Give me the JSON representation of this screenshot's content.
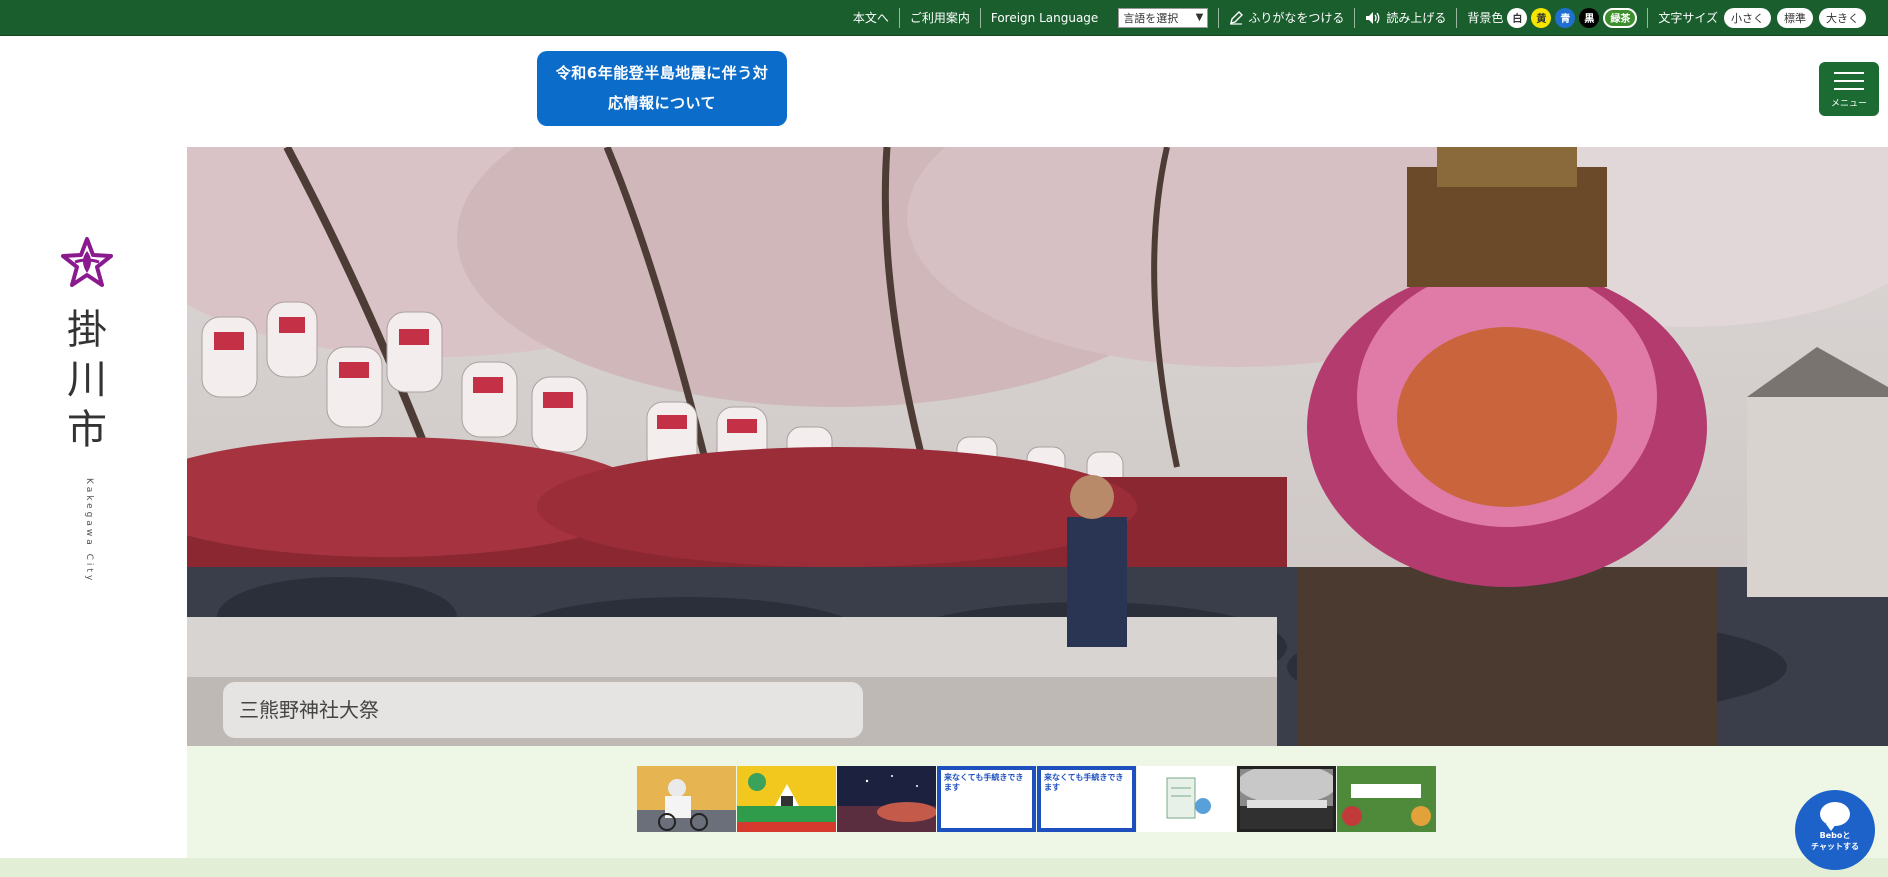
{
  "topbar": {
    "skip_to_main": "本文へ",
    "usage_guide": "ご利用案内",
    "foreign_language": "Foreign Language",
    "language_select": "言語を選択",
    "furigana": "ふりがなをつける",
    "read_aloud": "読み上げる",
    "bg_color_label": "背景色",
    "bg_options": [
      {
        "label": "白",
        "bg": "#ffffff",
        "fg": "#333333"
      },
      {
        "label": "黄",
        "bg": "#f5e400",
        "fg": "#333333"
      },
      {
        "label": "青",
        "bg": "#1f6fd1",
        "fg": "#ffffff"
      },
      {
        "label": "黒",
        "bg": "#000000",
        "fg": "#ffffff"
      },
      {
        "label": "緑茶",
        "bg": "#3d8f2d",
        "fg": "#ffffff"
      }
    ],
    "font_size_label": "文字サイズ",
    "font_sizes": [
      "小さく",
      "標準",
      "大きく"
    ],
    "bar_color": "#1b5e2e"
  },
  "header": {
    "notice_banner": "令和6年能登半島地震に伴う対応情報について",
    "notice_color": "#0b6cc9",
    "menu_label": "メニュー",
    "menu_color": "#1b6b33"
  },
  "logo": {
    "name_chars": [
      "掛",
      "川",
      "市"
    ],
    "name_en": "Kakegawa City",
    "star_color": "#8a1a8e"
  },
  "hero": {
    "caption": "三熊野神社大祭"
  },
  "banners": {
    "selected_index": 6,
    "items": [
      {
        "icon": "cyclist-photo"
      },
      {
        "icon": "castle-anniversary-banner"
      },
      {
        "icon": "night-sky-photo"
      },
      {
        "icon": "online-procedure-banner",
        "text": "来なくても手続きできます"
      },
      {
        "icon": "online-procedure-banner",
        "text": "来なくても手続きできます"
      },
      {
        "icon": "document-illustration"
      },
      {
        "icon": "festival-photo"
      },
      {
        "icon": "greenery-banner"
      }
    ]
  },
  "chat": {
    "line1": "Beboと",
    "line2": "チャットする",
    "color": "#1c62c8"
  }
}
